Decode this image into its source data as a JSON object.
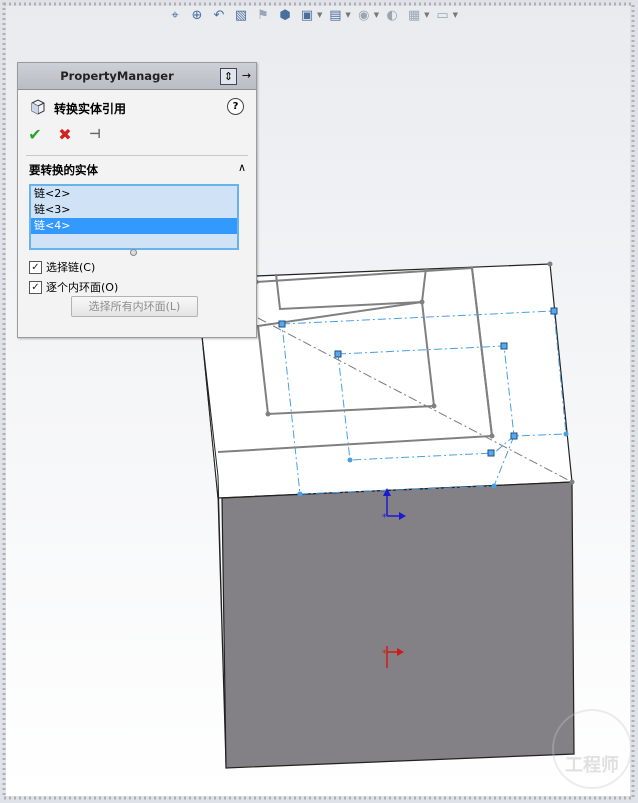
{
  "property_manager": {
    "title": "PropertyManager",
    "feature_name": "转换实体引用",
    "help_label": "?",
    "group_title": "要转换的实体",
    "list_items": [
      "链<2>",
      "链<3>",
      "链<4>"
    ],
    "selected_index": 2,
    "checkboxes": [
      {
        "label": "选择链(C)",
        "checked": true
      },
      {
        "label": "逐个内环面(O)",
        "checked": true
      }
    ],
    "select_all_button": "选择所有内环面(L)"
  },
  "icons": {
    "ok": "check-icon",
    "cancel": "close-icon",
    "pin": "pin-icon",
    "feature": "convert-entities-icon",
    "collapse": "chevron-up-icon"
  },
  "colors": {
    "ok": "#2ea02e",
    "cancel": "#d42020",
    "list_bg": "#cfe2f6",
    "list_selected": "#3399ff",
    "list_border": "#67b4ec",
    "sketch_line": "#808080",
    "construction_line": "#4a9fe0",
    "block_front": "#838086"
  },
  "watermark": "工程师"
}
